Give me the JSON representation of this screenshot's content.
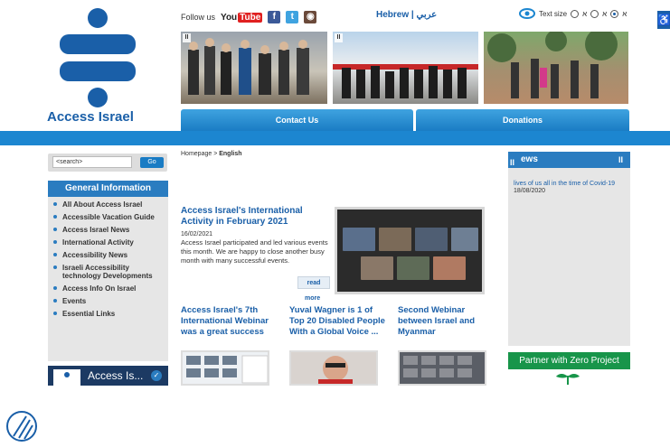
{
  "brand": {
    "logo_text": "Access Israel"
  },
  "topbar": {
    "follow_label": "Follow us",
    "youtube_label": "You",
    "youtube_badge": "Tube",
    "facebook_glyph": "f",
    "twitter_glyph": "t",
    "instagram_glyph": "◉",
    "language": "Hebrew | عربي",
    "text_size_label": "Text size",
    "text_size_options": [
      "א",
      "א",
      "א"
    ],
    "selected_text_size": 2
  },
  "photos": {
    "pause_glyph": "II"
  },
  "nav": {
    "contact_label": "Contact Us",
    "donations_label": "Donations"
  },
  "search": {
    "placeholder": "<search>",
    "go_label": "Go"
  },
  "general_info": {
    "heading": "General Information",
    "items": [
      "All About Access Israel",
      "Accessible Vacation Guide",
      "Access Israel News",
      "International Activity",
      "Accessibility News",
      "Israeli Accessibility technology Developments",
      "Access Info On Israel",
      "Events",
      "Essential Links"
    ]
  },
  "access_box": {
    "label": "Access Is..."
  },
  "breadcrumb": {
    "home": "Homepage",
    "separator": " > ",
    "current": "English"
  },
  "featured": {
    "title": "Access Israel's International Activity in February 2021",
    "date": "16/02/2021",
    "body": "Access Israel participated and led various events this month. We are happy to close another busy month with many successful events.",
    "read_label": "read",
    "more_label": "more"
  },
  "articles": [
    {
      "title": "Access Israel's 7th International Webinar was a great success"
    },
    {
      "title": "Yuval Wagner is 1 of Top 20 Disabled People With a Global Voice ..."
    },
    {
      "title": "Second Webinar between Israel and Myanmar"
    }
  ],
  "news": {
    "heading": "ews",
    "pause_glyph": "II",
    "item_text": "lives of us all in the time of Covid-19",
    "item_date": "18/08/2020"
  },
  "partner": {
    "label": "Partner with Zero Project"
  },
  "colors": {
    "brand_blue": "#1a5fa8",
    "nav_blue": "#1c86d0",
    "zero_green": "#18954a"
  }
}
